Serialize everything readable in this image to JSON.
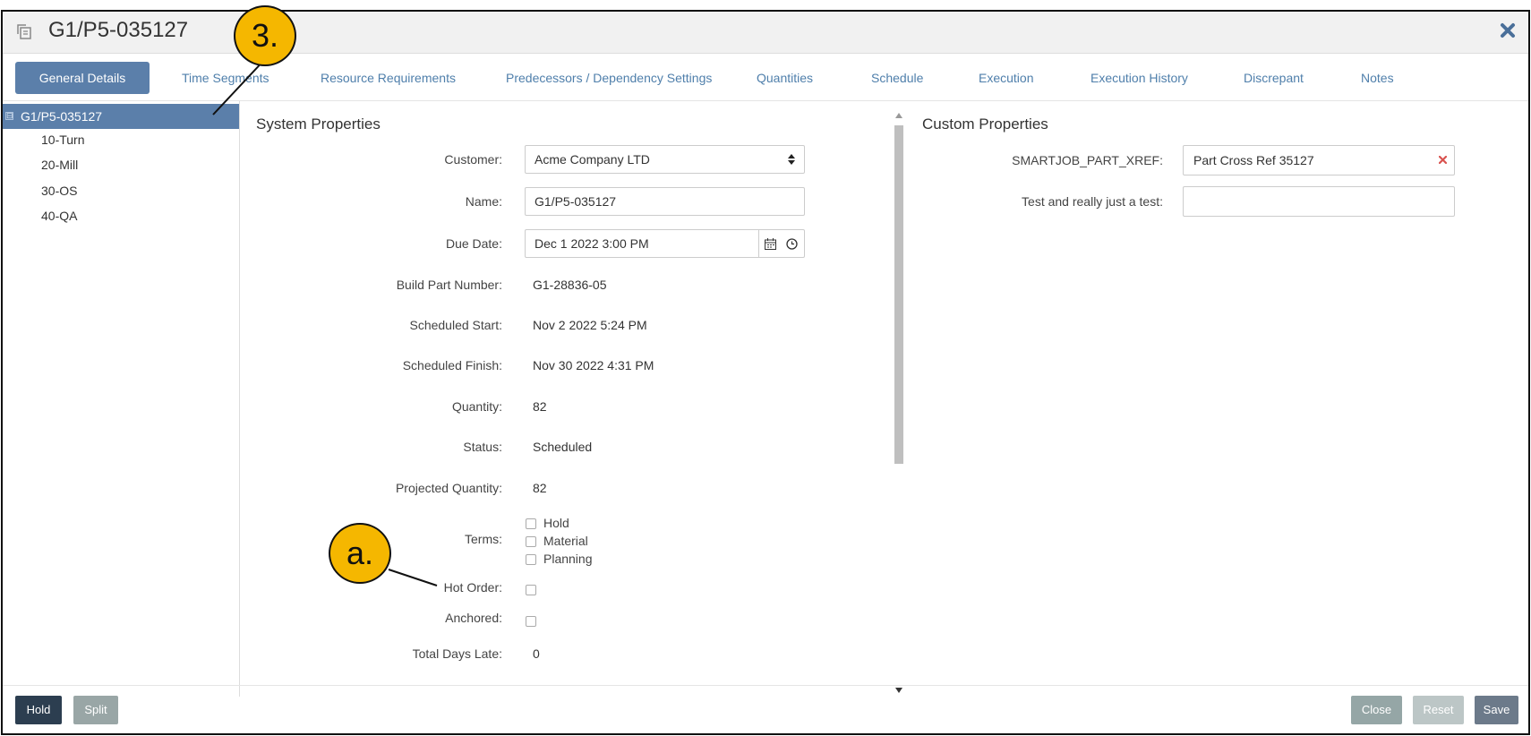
{
  "window": {
    "title": "G1/P5-035127",
    "title_icon": "copy-icon",
    "close_icon": "close-icon"
  },
  "tabs": [
    {
      "label": "General Details",
      "active": true
    },
    {
      "label": "Time Segments"
    },
    {
      "label": "Resource Requirements"
    },
    {
      "label": "Predecessors / Dependency Settings"
    },
    {
      "label": "Quantities"
    },
    {
      "label": "Schedule"
    },
    {
      "label": "Execution"
    },
    {
      "label": "Execution History"
    },
    {
      "label": "Discrepant"
    },
    {
      "label": "Notes"
    }
  ],
  "tree": {
    "root": "G1/P5-035127",
    "expander": "⊟",
    "children": [
      "10-Turn",
      "20-Mill",
      "30-OS",
      "40-QA"
    ]
  },
  "system_properties": {
    "title": "System Properties",
    "customer": {
      "label": "Customer:",
      "value": "Acme Company LTD"
    },
    "name": {
      "label": "Name:",
      "value": "G1/P5-035127"
    },
    "due_date": {
      "label": "Due Date:",
      "value": "Dec 1 2022 3:00 PM"
    },
    "build_part_number": {
      "label": "Build Part Number:",
      "value": "G1-28836-05"
    },
    "scheduled_start": {
      "label": "Scheduled Start:",
      "value": "Nov 2 2022 5:24 PM"
    },
    "scheduled_finish": {
      "label": "Scheduled Finish:",
      "value": "Nov 30 2022 4:31 PM"
    },
    "quantity": {
      "label": "Quantity:",
      "value": "82"
    },
    "status": {
      "label": "Status:",
      "value": "Scheduled"
    },
    "projected_quantity": {
      "label": "Projected Quantity:",
      "value": "82"
    },
    "terms": {
      "label": "Terms:",
      "options": [
        "Hold",
        "Material",
        "Planning"
      ]
    },
    "hot_order": {
      "label": "Hot Order:"
    },
    "anchored": {
      "label": "Anchored:"
    },
    "total_days_late": {
      "label": "Total Days Late:",
      "value": "0"
    }
  },
  "custom_properties": {
    "title": "Custom Properties",
    "fields": [
      {
        "label": "SMARTJOB_PART_XREF:",
        "value": "Part Cross Ref 35127"
      },
      {
        "label": "Test and really just a test:",
        "value": ""
      }
    ]
  },
  "footer": {
    "hold": "Hold",
    "split": "Split",
    "close": "Close",
    "reset": "Reset",
    "save": "Save"
  },
  "callouts": {
    "three": "3.",
    "a": "a."
  },
  "colors": {
    "accent": "#5b7faa",
    "tab_link": "#4f7fab",
    "hold_button": "#2c3e50",
    "callout": "#f5b700",
    "clear_icon": "#d9534f"
  }
}
